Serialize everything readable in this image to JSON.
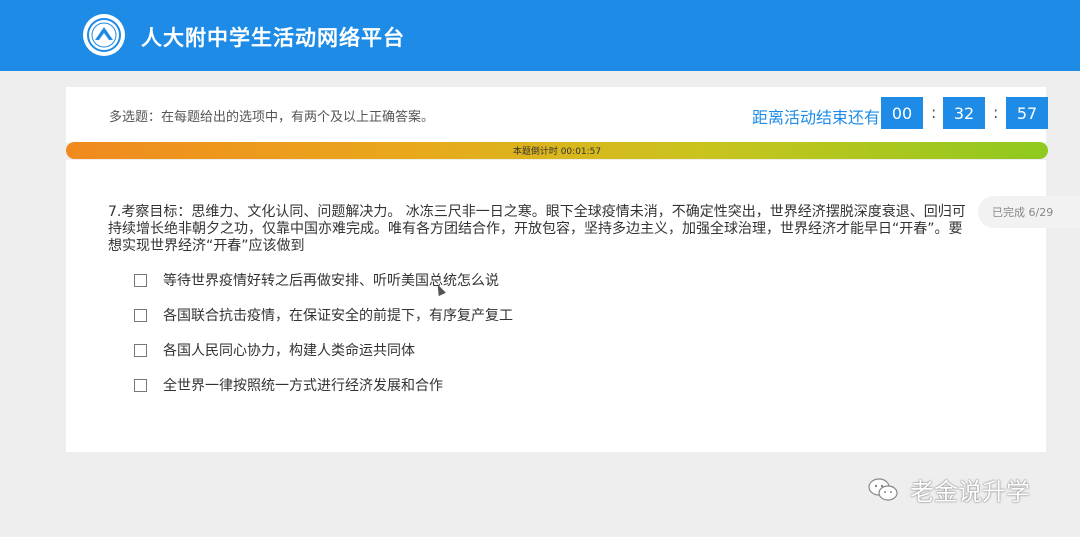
{
  "header": {
    "title": "人大附中学生活动网络平台",
    "logo_icon": "school-emblem-icon"
  },
  "instruction": "多选题：在每题给出的选项中，有两个及以上正确答案。",
  "countdown": {
    "label": "距离活动结束还有",
    "hours": "00",
    "minutes": "32",
    "seconds": "57",
    "separator": ":"
  },
  "question_timer": {
    "text": "本题倒计时 00:01:57"
  },
  "progress_badge": "已完成 6/29",
  "question": {
    "text": "7.考察目标：思维力、文化认同、问题解决力。 冰冻三尺非一日之寒。眼下全球疫情未消，不确定性突出，世界经济摆脱深度衰退、回归可持续增长绝非朝夕之功，仅靠中国亦难完成。唯有各方团结合作，开放包容，坚持多边主义，加强全球治理，世界经济才能早日“开春”。要想实现世界经济“开春”应该做到",
    "options": [
      {
        "label": "等待世界疫情好转之后再做安排、听听美国总统怎么说",
        "checked": false
      },
      {
        "label": "各国联合抗击疫情，在保证安全的前提下，有序复产复工",
        "checked": false
      },
      {
        "label": "各国人民同心协力，构建人类命运共同体",
        "checked": false
      },
      {
        "label": "全世界一律按照统一方式进行经济发展和合作",
        "checked": false
      }
    ]
  },
  "watermark": {
    "text": "老金说升学",
    "icon": "wechat-icon"
  },
  "colors": {
    "header_blue": "#1e8ce6",
    "accent": "#1e8ce6"
  }
}
